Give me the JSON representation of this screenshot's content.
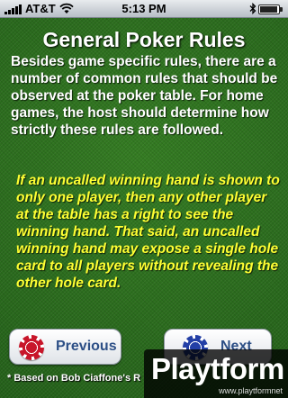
{
  "status_bar": {
    "carrier": "AT&T",
    "time": "5:13 PM",
    "wifi_icon": "wifi-icon",
    "bluetooth_icon": "bluetooth-icon"
  },
  "content": {
    "title": "General Poker Rules",
    "intro": "Besides game specific rules, there are a number of common rules that should be observed at the poker table. For home games, the host should determine how strictly these rules are followed.",
    "rule": "If an uncalled winning hand is shown to only one player, then any other player at the table has a right to see the winning hand. That said, an uncalled winning hand may expose a single hole card to all players without revealing the other hole card."
  },
  "navigation": {
    "previous_label": "Previous",
    "next_label": "Next",
    "previous_chip_color": "#c8162a",
    "next_chip_color": "#233fa6"
  },
  "footnote": "* Based on Bob Ciaffone's R",
  "watermark": {
    "logo": "Playtform",
    "url": "www.playtformnet"
  },
  "colors": {
    "felt": "#2a6a1c",
    "rule_text": "#ffff33",
    "button_text": "#2c4f86"
  }
}
